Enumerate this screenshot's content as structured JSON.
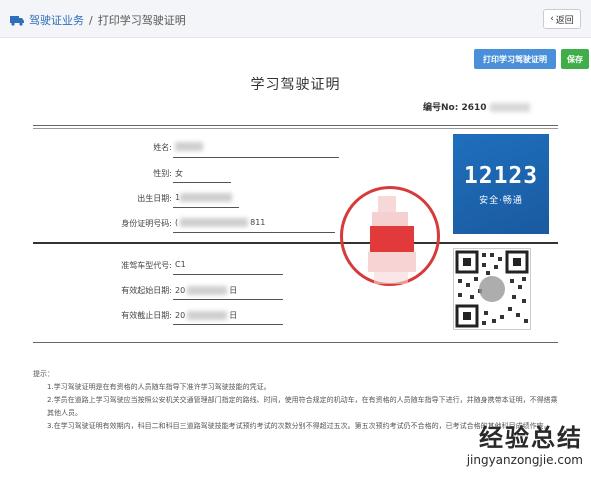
{
  "breadcrumb": {
    "parent": "驾驶证业务",
    "separator": "/",
    "current": "打印学习驾驶证明"
  },
  "toolbar": {
    "back_label": "返回",
    "print_label": "打印学习驾驶证明",
    "save_label": "保存"
  },
  "document": {
    "title": "学习驾驶证明",
    "serial_label": "编号No: 2610",
    "fields": [
      {
        "label": "姓名:",
        "value": ""
      },
      {
        "label": "性别:",
        "value": "女"
      },
      {
        "label": "出生日期:",
        "value": "1"
      },
      {
        "label": "身份证明号码:",
        "value": "(",
        "value_suffix": "811"
      },
      {
        "label": "准驾车型代号:",
        "value": "C1"
      },
      {
        "label": "有效起始日期:",
        "value": "20",
        "value_suffix": "日"
      },
      {
        "label": "有效截止日期:",
        "value": "20",
        "value_suffix": "日"
      }
    ],
    "logo": {
      "number": "12123",
      "subtitle": "安全·畅通"
    }
  },
  "notes": {
    "heading": "提示：",
    "items": [
      "1.学习驾驶证明是在有资格的人员随车指导下准许学习驾驶技能的凭证。",
      "2.学员在道路上学习驾驶应当按照公安机关交通管理部门指定的路线、时间，使用符合规定的机动车，在有资格的人员随车指导下进行，并随身携带本证明，不得搭乘其他人员。",
      "3.在学习驾驶证明有效期内，科目二和科目三道路驾驶技能考试预约考试的次数分别不得超过五次。第五次预约考试仍不合格的，已考试合格的其他科目成绩作废。"
    ]
  },
  "watermark": {
    "cn": "经验总结",
    "en": "jingyanzongjie.com"
  },
  "colors": {
    "primary": "#4a8fd9",
    "save": "#3fae49",
    "stamp": "#d63a3a",
    "logo_bg": "#1f6fbd"
  }
}
